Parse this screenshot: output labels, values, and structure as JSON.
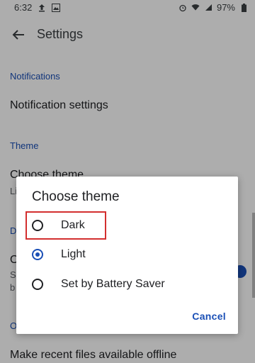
{
  "status": {
    "time": "6:32",
    "battery": "97%"
  },
  "appbar": {
    "title": "Settings"
  },
  "list": {
    "notifications_header": "Notifications",
    "notification_settings": "Notification settings",
    "theme_header": "Theme",
    "choose_theme_item": "Choose theme",
    "choose_theme_sub": "Li",
    "d_header": "D",
    "o_item": "O",
    "s_sub": "S",
    "b_sub": "b",
    "o_header": "O",
    "offline_item": "Make recent files available offline"
  },
  "dialog": {
    "title": "Choose theme",
    "options": [
      {
        "label": "Dark",
        "selected": false
      },
      {
        "label": "Light",
        "selected": true
      },
      {
        "label": "Set by Battery Saver",
        "selected": false
      }
    ],
    "cancel_label": "Cancel"
  },
  "colors": {
    "accent": "#1a4fb6",
    "highlight": "#d32f2f"
  }
}
